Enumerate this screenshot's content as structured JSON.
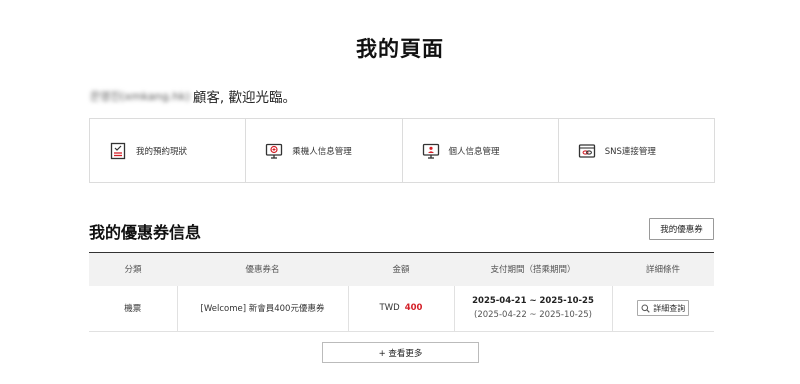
{
  "page_title": "我的頁面",
  "welcome": {
    "name": "은영진(xmkang.hk)",
    "suffix": "顧客, 歡迎光臨。"
  },
  "quick_menu": [
    {
      "label": "我的預約現狀",
      "icon": "reservation-icon"
    },
    {
      "label": "乘機人信息管理",
      "icon": "passenger-monitor-icon"
    },
    {
      "label": "個人信息管理",
      "icon": "personal-info-monitor-icon"
    },
    {
      "label": "SNS連接管理",
      "icon": "sns-link-icon"
    }
  ],
  "coupons": {
    "title": "我的優惠券信息",
    "my_coupons_button": "我的優惠券",
    "headers": [
      "分類",
      "優惠券名",
      "金額",
      "支付期間（搭乘期間）",
      "詳細條件"
    ],
    "rows": [
      {
        "category": "機票",
        "name": "[Welcome] 新會員400元優惠券",
        "currency": "TWD",
        "amount": "400",
        "pay_period": "2025-04-21 ~ 2025-10-25",
        "board_period": "(2025-04-22 ~ 2025-10-25)",
        "detail_button": "詳細查詢"
      }
    ],
    "more_button": "+ 查看更多"
  },
  "colors": {
    "accent_red": "#d42028",
    "border": "#dcdcdc",
    "header_bg": "#f2f2f2"
  }
}
